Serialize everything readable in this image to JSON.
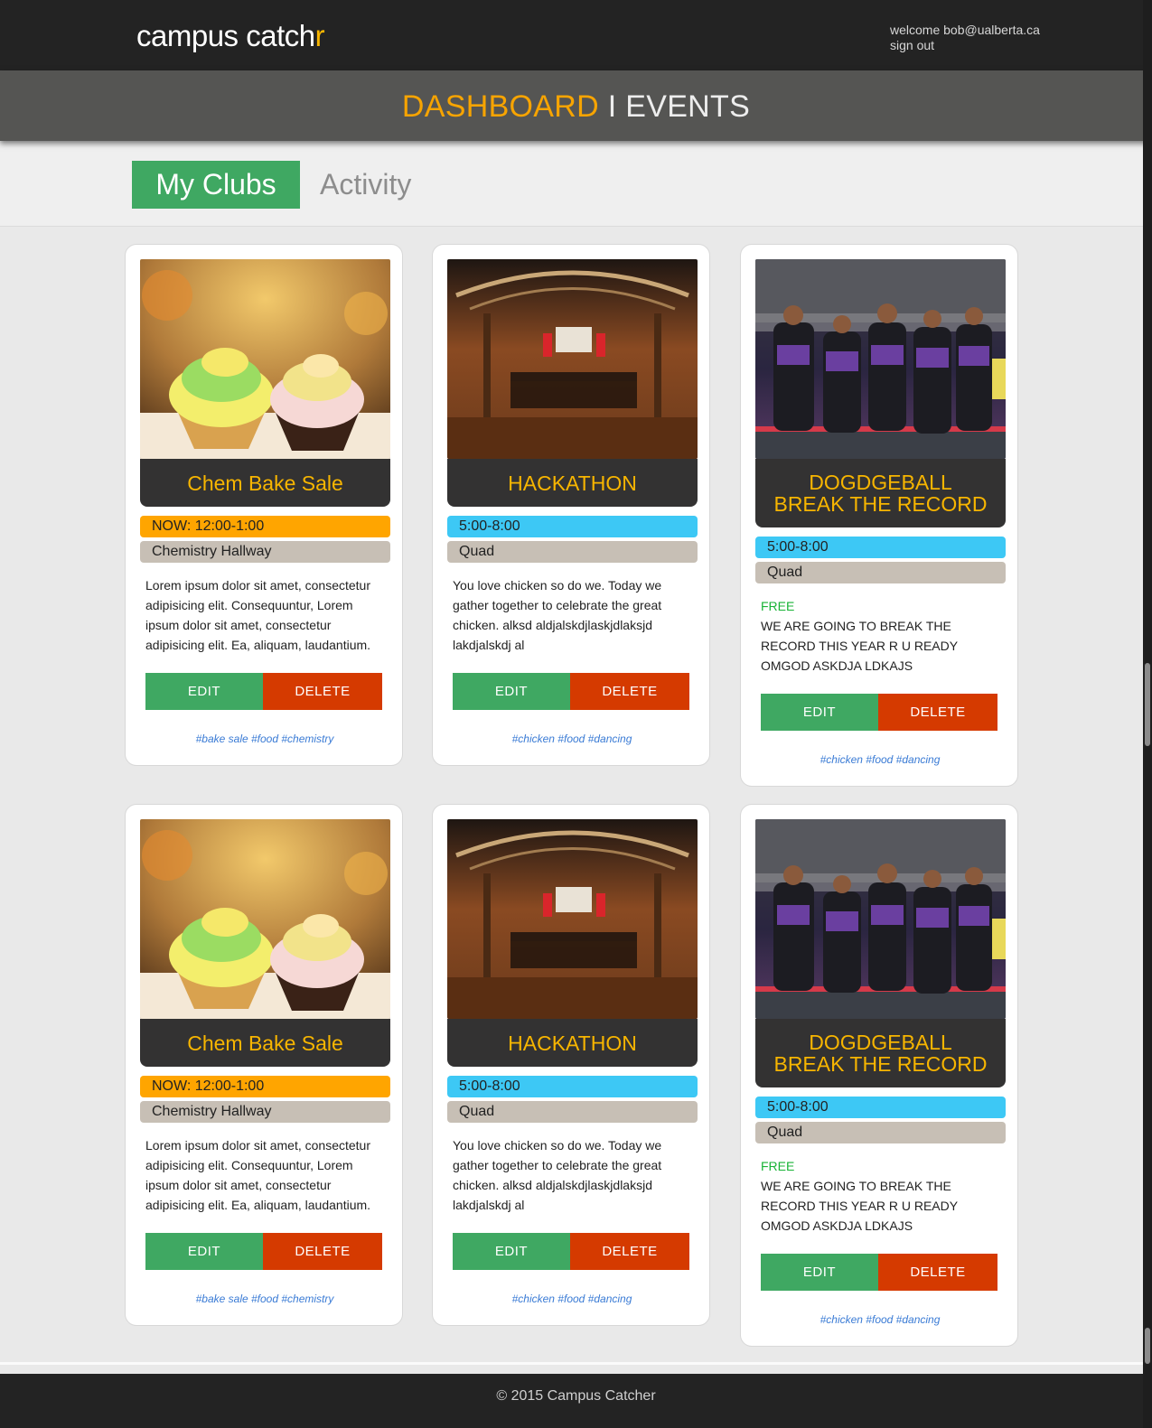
{
  "header": {
    "logo_main": "campus catch",
    "logo_accent": "r",
    "welcome": "welcome bob@ualberta.ca",
    "signout": "sign out"
  },
  "subheader": {
    "dashboard": "DASHBOARD",
    "separator": "I",
    "events": "EVENTS"
  },
  "tabs": {
    "active": "My Clubs",
    "inactive": "Activity"
  },
  "colors": {
    "accent": "#f7a400",
    "green": "#3fa862",
    "red": "#d53a00",
    "orange": "#ffa500",
    "blue": "#3dc8f5",
    "location": "#c7bfb5",
    "dark": "#333232"
  },
  "cards": [
    {
      "image": "cupcakes-photo",
      "title": "Chem Bake Sale",
      "time": "NOW: 12:00-1:00",
      "time_color": "orange",
      "location": "Chemistry Hallway",
      "free": "",
      "description": "Lorem ipsum dolor sit amet, consectetur adipisicing elit. Consequuntur, Lorem ipsum dolor sit amet, consectetur adipisicing elit. Ea, aliquam, laudantium.",
      "edit": "EDIT",
      "delete": "DELETE",
      "tags": "#bake sale #food #chemistry"
    },
    {
      "image": "hackathon-venue-photo",
      "title": "HACKATHON",
      "time": "5:00-8:00",
      "time_color": "blue",
      "location": "Quad",
      "free": "",
      "description": "You love chicken so do we. Today we gather together to celebrate the great chicken. alksd aldjalskdjlaskjdlaksjd lakdjalskdj al",
      "edit": "EDIT",
      "delete": "DELETE",
      "tags": "#chicken #food #dancing"
    },
    {
      "image": "dodgeball-team-photo",
      "title": "DOGDGEBALL BREAK THE RECORD",
      "time": "5:00-8:00",
      "time_color": "blue",
      "location": "Quad",
      "free": "FREE",
      "description": "WE ARE GOING TO BREAK THE RECORD THIS YEAR R U READY OMGOD ASKDJA LDKAJS",
      "edit": "EDIT",
      "delete": "DELETE",
      "tags": "#chicken #food #dancing"
    },
    {
      "image": "cupcakes-photo",
      "title": "Chem Bake Sale",
      "time": "NOW: 12:00-1:00",
      "time_color": "orange",
      "location": "Chemistry Hallway",
      "free": "",
      "description": "Lorem ipsum dolor sit amet, consectetur adipisicing elit. Consequuntur, Lorem ipsum dolor sit amet, consectetur adipisicing elit. Ea, aliquam, laudantium.",
      "edit": "EDIT",
      "delete": "DELETE",
      "tags": "#bake sale #food #chemistry"
    },
    {
      "image": "hackathon-venue-photo",
      "title": "HACKATHON",
      "time": "5:00-8:00",
      "time_color": "blue",
      "location": "Quad",
      "free": "",
      "description": "You love chicken so do we. Today we gather together to celebrate the great chicken. alksd aldjalskdjlaskjdlaksjd lakdjalskdj al",
      "edit": "EDIT",
      "delete": "DELETE",
      "tags": "#chicken #food #dancing"
    },
    {
      "image": "dodgeball-team-photo",
      "title": "DOGDGEBALL BREAK THE RECORD",
      "time": "5:00-8:00",
      "time_color": "blue",
      "location": "Quad",
      "free": "FREE",
      "description": "WE ARE GOING TO BREAK THE RECORD THIS YEAR R U READY OMGOD ASKDJA LDKAJS",
      "edit": "EDIT",
      "delete": "DELETE",
      "tags": "#chicken #food #dancing"
    }
  ],
  "footer": {
    "copyright": "© 2015 Campus Catcher"
  }
}
